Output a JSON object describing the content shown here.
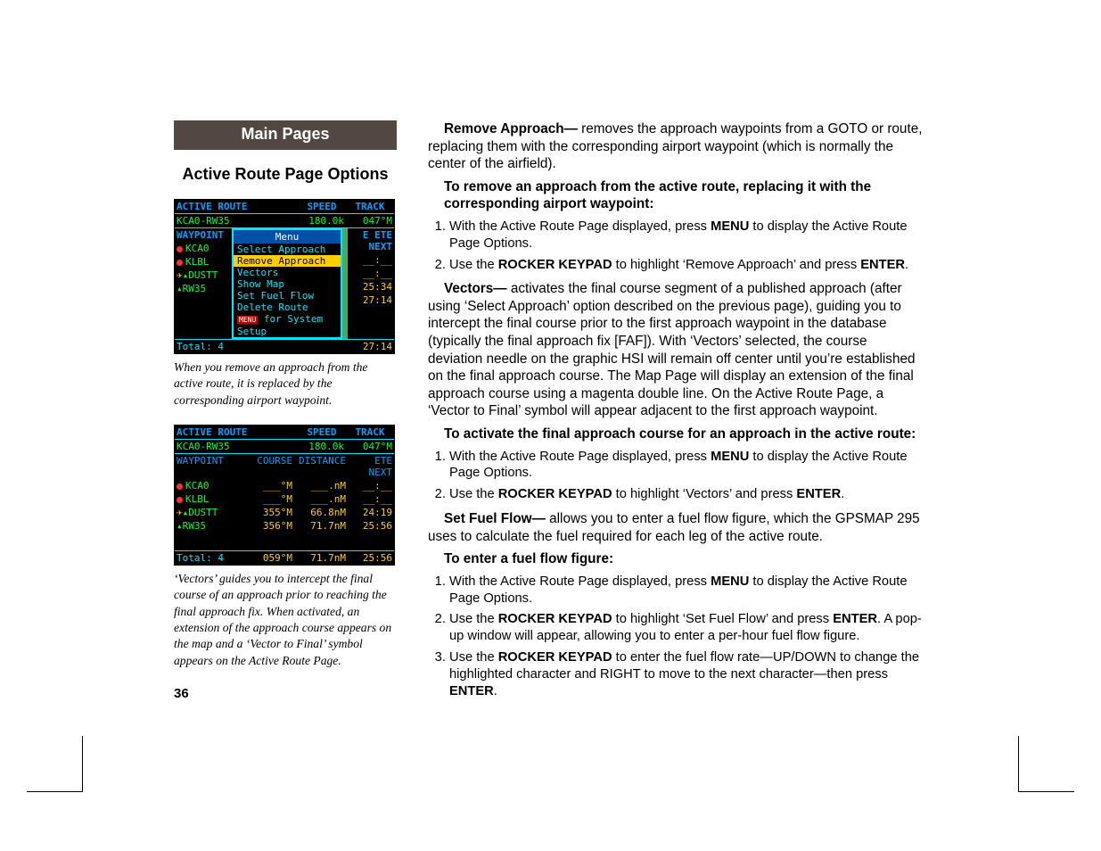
{
  "header": {
    "main": "Main Pages",
    "sub": "Active Route Page Options"
  },
  "page_number": "36",
  "shot1": {
    "title": "ACTIVE ROUTE",
    "speed_h": "SPEED",
    "track_h": "TRACK",
    "route": "KCA0-RW35",
    "speed": "180.0k",
    "track": "047°M",
    "cols": {
      "wp": "WAYPOINT",
      "c2": "E",
      "c3": "ETE NEXT"
    },
    "menu_title": "Menu",
    "menu": {
      "m1": "Select Approach",
      "m2": "Remove Approach",
      "m3": "Vectors",
      "m4": "Show Map",
      "m5": "Set Fuel Flow",
      "m6": "Delete Route",
      "m7": "for System Setup",
      "m7_tag": "MENU"
    },
    "wp1": "KCA0",
    "wp2": "KLBL",
    "wp3": "DUSTT",
    "wp4": "RW35",
    "ete3": "25:34",
    "ete4": "27:14",
    "total_l": "Total: 4",
    "total_r": "27:14"
  },
  "caption1": "When you remove an approach from the active route, it is replaced by the corresponding airport waypoint.",
  "shot2": {
    "title": "ACTIVE ROUTE",
    "speed_h": "SPEED",
    "track_h": "TRACK",
    "route": "KCA0-RW35",
    "speed": "180.0k",
    "track": "047°M",
    "cols": {
      "wp": "WAYPOINT",
      "crs": "COURSE",
      "dist": "DISTANCE",
      "ete": "ETE NEXT"
    },
    "r1": {
      "wp": "KCA0",
      "crs": "___°M",
      "dist": "___.nM",
      "ete": "__:__"
    },
    "r2": {
      "wp": "KLBL",
      "crs": "___°M",
      "dist": "___.nM",
      "ete": "__:__"
    },
    "r3": {
      "wp": "DUSTT",
      "crs": "355°M",
      "dist": "66.8nM",
      "ete": "24:19"
    },
    "r4": {
      "wp": "RW35",
      "crs": "356°M",
      "dist": "71.7nM",
      "ete": "25:56"
    },
    "total_l": "Total: 4",
    "total_c": "059°M",
    "total_d": "71.7nM",
    "total_e": "25:56"
  },
  "caption2": "‘Vectors’ guides you to intercept the final course of an approach prior to reaching the final approach fix. When activated, an extension of the approach course appears on the map and a ‘Vector to Final’ symbol appears on the Active Route Page.",
  "right": {
    "remove_lead": "Remove Approach—",
    "remove_body": " removes the approach waypoints from a GOTO or route, replacing them with the corresponding airport waypoint (which is normally the center of the airfield).",
    "remove_head": "To remove an approach from the active route, replacing it with the corresponding airport waypoint:",
    "remove_s1a": "With the Active Route Page displayed, press ",
    "remove_s1b": "MENU",
    "remove_s1c": " to display the Active Route Page Options.",
    "remove_s2a": "Use the ",
    "remove_s2b": "ROCKER KEYPAD",
    "remove_s2c": " to highlight ‘Remove Approach’ and press ",
    "remove_s2d": "ENTER",
    "remove_s2e": ".",
    "vectors_lead": "Vectors—",
    "vectors_body": " activates the final course segment of a published approach (after using ‘Select Approach’ option described on the previous page), guiding you to intercept the final course prior to the first approach waypoint in the database (typically the final approach fix [FAF]). With ‘Vectors’ selected, the course deviation needle on the graphic HSI will remain off center until you’re established on the final approach course. The Map Page will display an extension of the final approach course using a magenta double line. On the Active Route Page, a ‘Vector to Final’ symbol will appear adjacent to the first approach waypoint.",
    "vectors_head": "To activate the final approach course for an approach in the active route:",
    "vectors_s1a": "With the Active Route Page displayed, press ",
    "vectors_s1b": "MENU",
    "vectors_s1c": " to display the Active Route Page Options.",
    "vectors_s2a": "Use the ",
    "vectors_s2b": "ROCKER KEYPAD",
    "vectors_s2c": " to highlight ‘Vectors’ and press ",
    "vectors_s2d": "ENTER",
    "vectors_s2e": ".",
    "fuel_lead": "Set Fuel Flow—",
    "fuel_body": " allows you to enter a fuel flow figure, which the GPSMAP 295 uses to calculate the fuel required for each leg of the active route.",
    "fuel_head": "To enter a fuel flow figure:",
    "fuel_s1a": "With the Active Route Page displayed, press ",
    "fuel_s1b": "MENU",
    "fuel_s1c": " to display the Active Route Page Options.",
    "fuel_s2a": "Use the ",
    "fuel_s2b": "ROCKER KEYPAD",
    "fuel_s2c": " to highlight ‘Set Fuel Flow’ and press ",
    "fuel_s2d": "ENTER",
    "fuel_s2e": ". A pop-up window will appear, allowing you to enter a per-hour fuel flow figure.",
    "fuel_s3a": "Use the ",
    "fuel_s3b": "ROCKER KEYPAD",
    "fuel_s3c": " to enter the fuel flow rate—UP/DOWN to change the highlighted character and RIGHT to move to the next character—then press ",
    "fuel_s3d": "ENTER",
    "fuel_s3e": "."
  }
}
